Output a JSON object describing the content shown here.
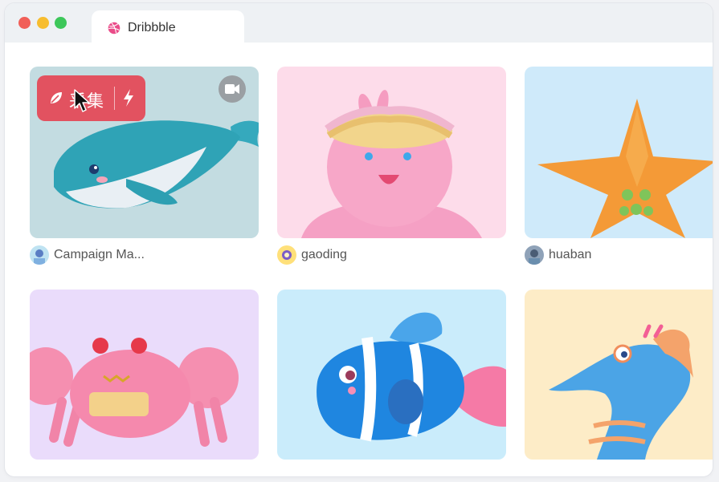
{
  "browser": {
    "traffic_lights": {
      "close_color": "#f15f58",
      "minimize_color": "#f7bd2f",
      "maximize_color": "#3dc75a"
    },
    "tab": {
      "title": "Dribbble",
      "icon": "dribbble-icon",
      "icon_color": "#ea4c89"
    }
  },
  "overlay": {
    "collect_label": "采集",
    "collect_icon": "leaf-icon",
    "quick_icon": "lightning-icon",
    "video_icon": "video-camera-icon",
    "accent": "#e25260"
  },
  "shots": [
    {
      "author": "Campaign Ma...",
      "subject": "whale",
      "background": "#c3dce1"
    },
    {
      "author": "gaoding",
      "subject": "pink octopus",
      "background": "#fddcea"
    },
    {
      "author": "huaban",
      "subject": "starfish",
      "background": "#cfeafa"
    },
    {
      "author": "",
      "subject": "crab",
      "background": "#eadcfb"
    },
    {
      "author": "",
      "subject": "clownfish",
      "background": "#caecfb"
    },
    {
      "author": "",
      "subject": "seahorse",
      "background": "#fdecc7"
    }
  ]
}
